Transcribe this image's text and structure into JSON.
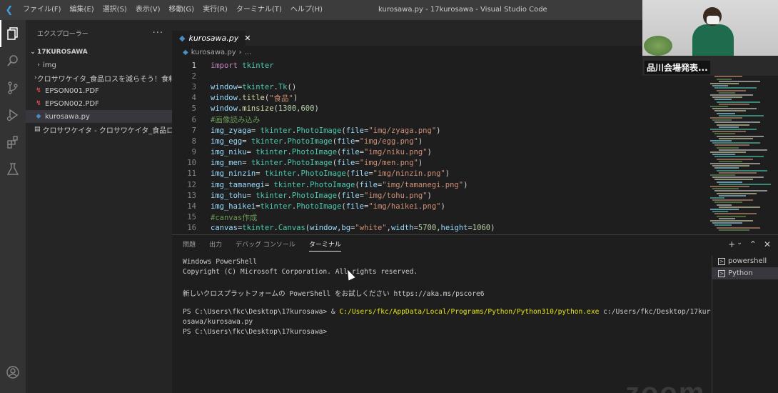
{
  "titlebar": {
    "menu": [
      "ファイル(F)",
      "編集(E)",
      "選択(S)",
      "表示(V)",
      "移動(G)",
      "実行(R)",
      "ターミナル(T)",
      "ヘルプ(H)"
    ],
    "window_title": "kurosawa.py - 17kurosawa - Visual Studio Code"
  },
  "activitybar": {
    "icons": [
      "explorer-icon",
      "search-icon",
      "source-control-icon",
      "run-debug-icon",
      "extensions-icon",
      "testing-icon",
      "account-icon"
    ]
  },
  "sidebar": {
    "header": "エクスプローラー",
    "root": "17KUROSAWA",
    "items": [
      {
        "label": "img",
        "type": "folder"
      },
      {
        "label": "クロサワケイタ_食品ロスを減らそう！食料...",
        "type": "folder"
      },
      {
        "label": "EPSON001.PDF",
        "type": "pdf"
      },
      {
        "label": "EPSON002.PDF",
        "type": "pdf"
      },
      {
        "label": "kurosawa.py",
        "type": "py"
      },
      {
        "label": "クロサワケイタ - クロサワケイタ_食品ロスを...",
        "type": "doc"
      }
    ]
  },
  "editor": {
    "tab": "kurosawa.py",
    "breadcrumb": "kurosawa.py",
    "breadcrumb_more": "...",
    "lines": [
      {
        "n": "1",
        "text": "import tkinter"
      },
      {
        "n": "2",
        "text": ""
      },
      {
        "n": "3",
        "text": "window=tkinter.Tk()"
      },
      {
        "n": "4",
        "text": "window.title(\"食品\")"
      },
      {
        "n": "5",
        "text": "window.minsize(1300,600)"
      },
      {
        "n": "6",
        "text": "#画像読み込み"
      },
      {
        "n": "7",
        "text": "img_zyaga= tkinter.PhotoImage(file=\"img/zyaga.png\")"
      },
      {
        "n": "8",
        "text": "img_egg= tkinter.PhotoImage(file=\"img/egg.png\")"
      },
      {
        "n": "9",
        "text": "img_niku= tkinter.PhotoImage(file=\"img/niku.png\")"
      },
      {
        "n": "10",
        "text": "img_men= tkinter.PhotoImage(file=\"img/men.png\")"
      },
      {
        "n": "11",
        "text": "img_ninzin= tkinter.PhotoImage(file=\"img/ninzin.png\")"
      },
      {
        "n": "12",
        "text": "img_tamanegi= tkinter.PhotoImage(file=\"img/tamanegi.png\")"
      },
      {
        "n": "13",
        "text": "img_tohu= tkinter.PhotoImage(file=\"img/tohu.png\")"
      },
      {
        "n": "14",
        "text": "img_haikei=tkinter.PhotoImage(file=\"img/haikei.png\")"
      },
      {
        "n": "15",
        "text": "#canvas作成"
      },
      {
        "n": "16",
        "text": "canvas=tkinter.Canvas(window,bg=\"white\",width=5700,height=1060)"
      }
    ]
  },
  "panel": {
    "tabs": [
      "問題",
      "出力",
      "デバッグ コンソール",
      "ターミナル"
    ],
    "active_tab": "ターミナル",
    "terminal_lines": [
      "Windows PowerShell",
      "Copyright (C) Microsoft Corporation. All rights reserved.",
      "",
      "新しいクロスプラットフォームの PowerShell をお試しください https://aka.ms/pscore6",
      "",
      "PS C:\\Users\\fkc\\Desktop\\17kurosawa> & C:/Users/fkc/AppData/Local/Programs/Python/Python310/python.exe c:/Users/fkc/Desktop/17kur",
      "osawa/kurosawa.py",
      "PS C:\\Users\\fkc\\Desktop\\17kurosawa>"
    ],
    "terminals": [
      "powershell",
      "Python"
    ]
  },
  "overlay": {
    "participant_name": "品川会場発表...",
    "watermark": "zoom"
  }
}
